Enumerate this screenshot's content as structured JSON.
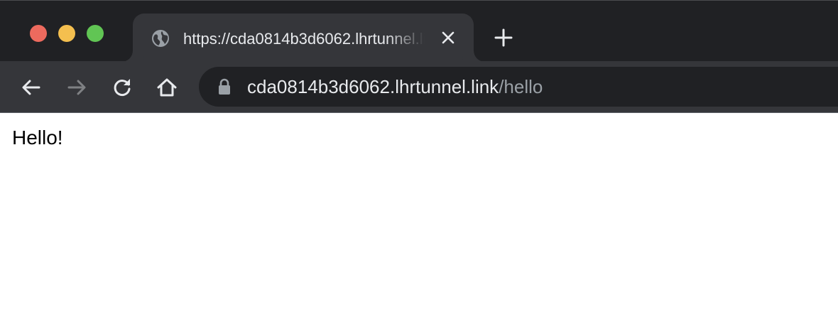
{
  "window": {
    "traffic_lights": {
      "close_color": "#ed6a5e",
      "minimize_color": "#f4bf4f",
      "maximize_color": "#61c554"
    }
  },
  "tabs": [
    {
      "title": "https://cda0814b3d6062.lhrtunnel.link/hello",
      "favicon": "globe-icon",
      "active": true
    }
  ],
  "toolbar": {
    "back_icon": "arrow-left-icon",
    "forward_icon": "arrow-right-icon",
    "reload_icon": "reload-icon",
    "home_icon": "home-icon",
    "forward_enabled": false
  },
  "address_bar": {
    "secure_icon": "lock-icon",
    "host": "cda0814b3d6062.lhrtunnel.link",
    "path": "/hello"
  },
  "page": {
    "text": "Hello!"
  },
  "colors": {
    "frame": "#202124",
    "toolbar": "#35363a",
    "text_primary": "#e8eaed",
    "text_dim": "#9aa0a6"
  }
}
